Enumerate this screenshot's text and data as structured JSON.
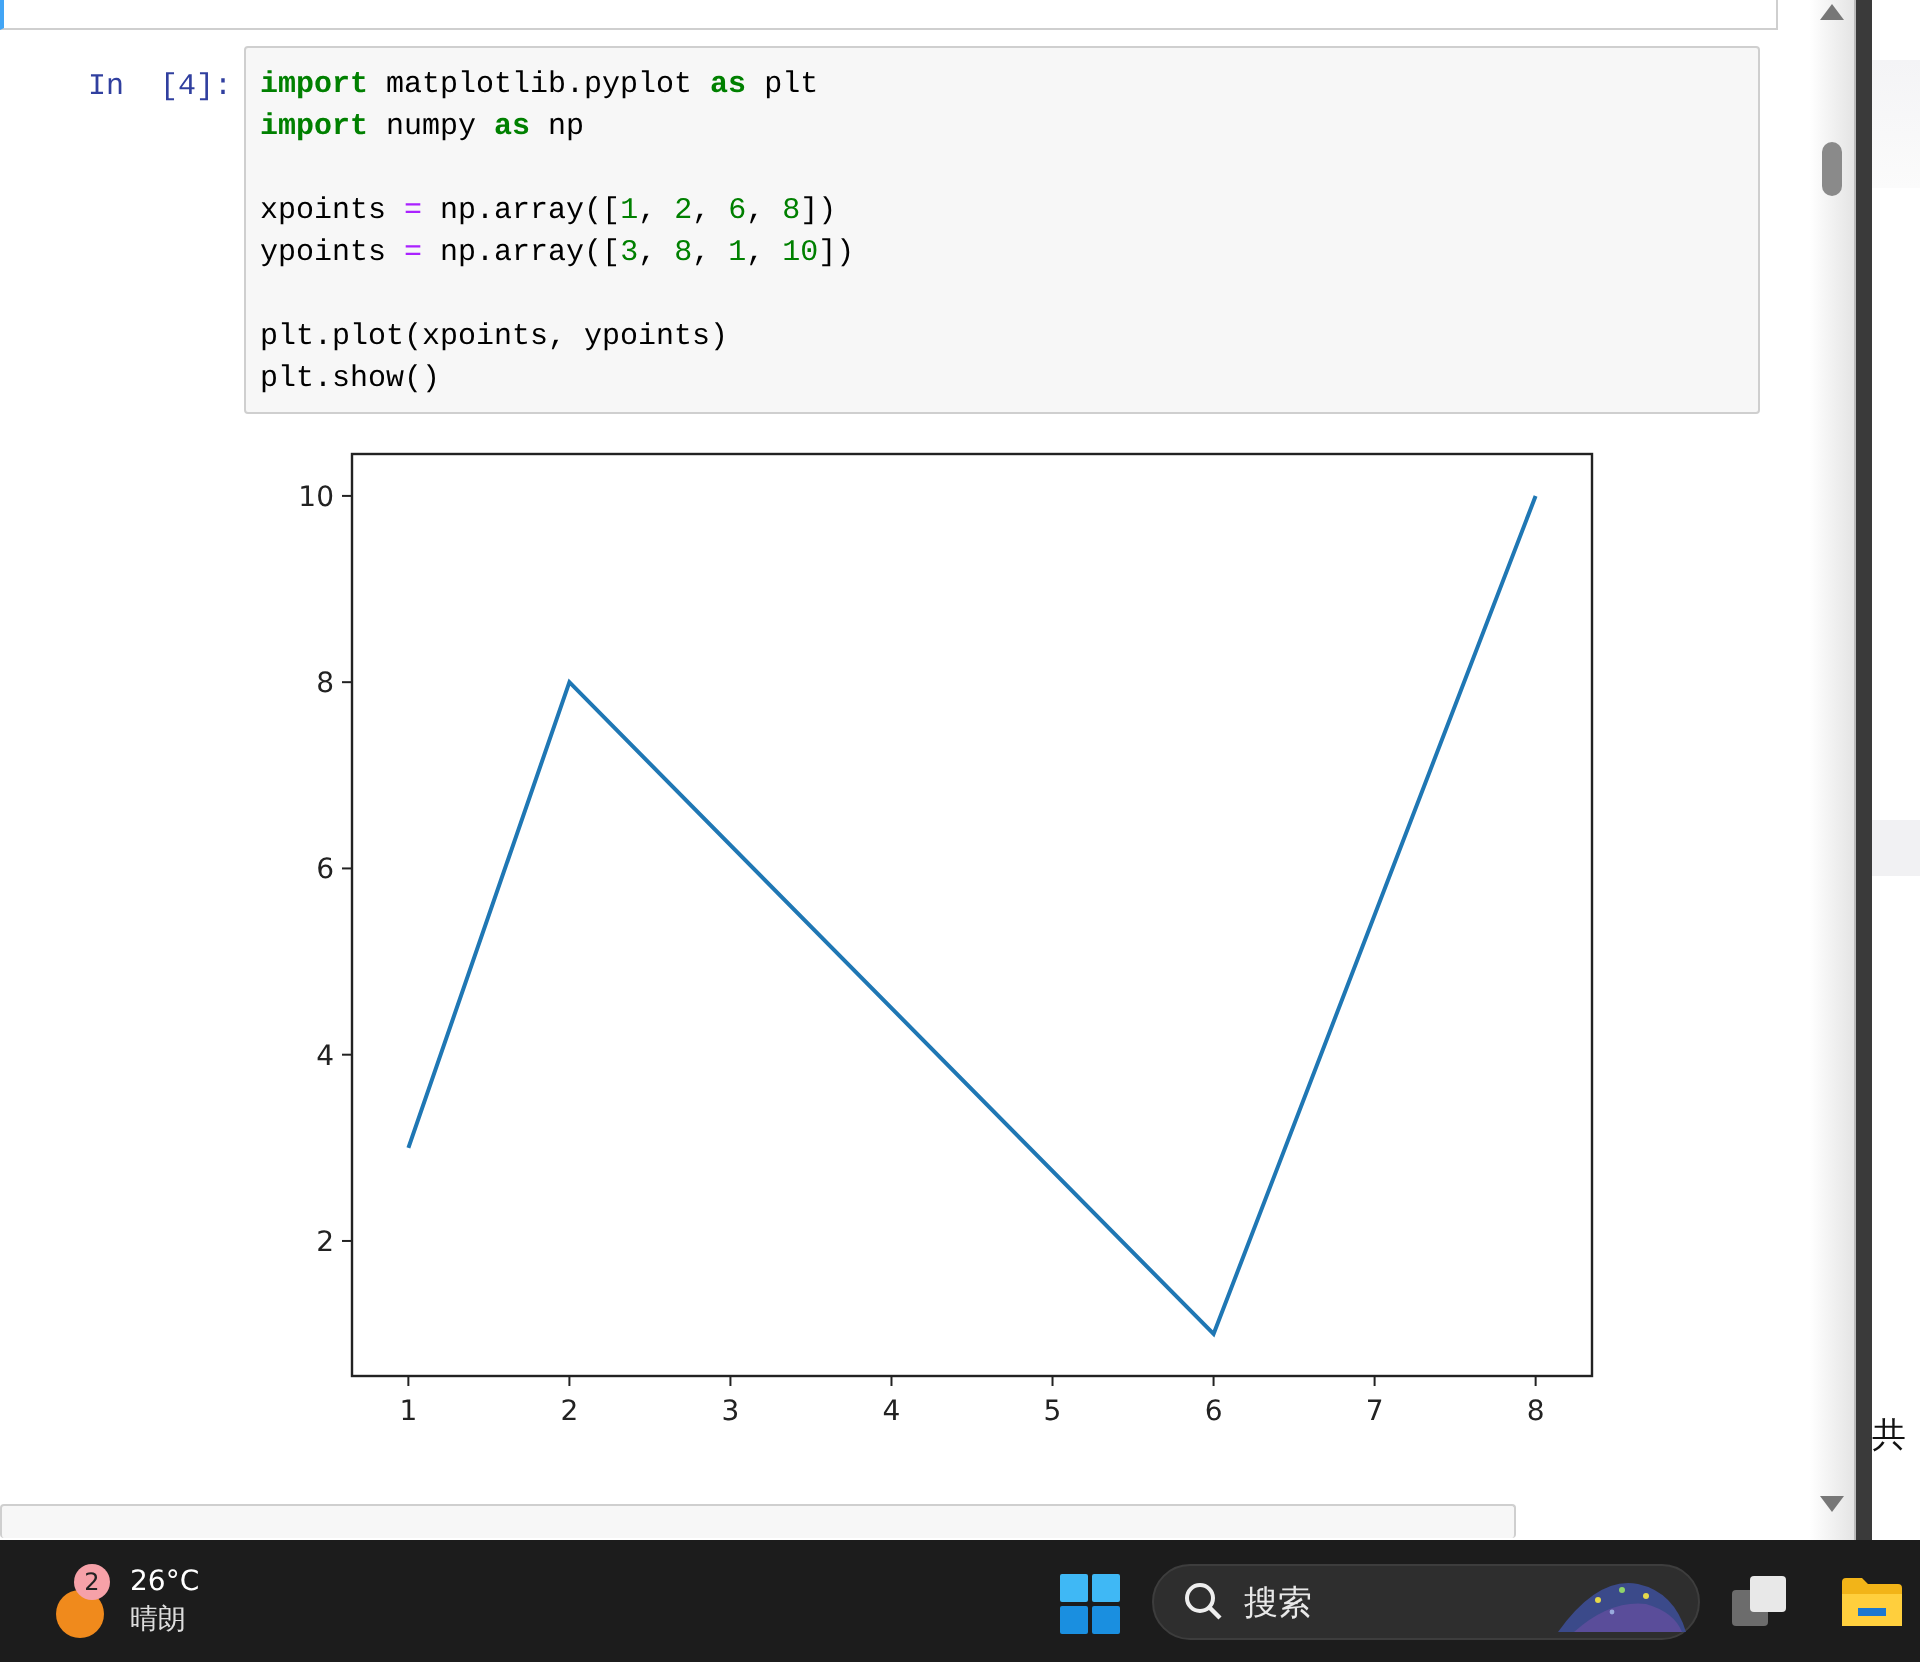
{
  "cell": {
    "prompt": "In  [4]:",
    "lines": [
      {
        "kind": "code",
        "tokens": [
          {
            "kind": "keyword",
            "text": "import"
          },
          {
            "kind": "plain",
            "text": " matplotlib.pyplot "
          },
          {
            "kind": "keyword",
            "text": "as"
          },
          {
            "kind": "plain",
            "text": " plt"
          }
        ]
      },
      {
        "kind": "code",
        "tokens": [
          {
            "kind": "keyword",
            "text": "import"
          },
          {
            "kind": "plain",
            "text": " numpy "
          },
          {
            "kind": "keyword",
            "text": "as"
          },
          {
            "kind": "plain",
            "text": " np"
          }
        ]
      },
      {
        "kind": "blank"
      },
      {
        "kind": "code",
        "tokens": [
          {
            "kind": "plain",
            "text": "xpoints "
          },
          {
            "kind": "operator",
            "text": "="
          },
          {
            "kind": "plain",
            "text": " np.array(["
          },
          {
            "kind": "number",
            "text": "1"
          },
          {
            "kind": "plain",
            "text": ", "
          },
          {
            "kind": "number",
            "text": "2"
          },
          {
            "kind": "plain",
            "text": ", "
          },
          {
            "kind": "number",
            "text": "6"
          },
          {
            "kind": "plain",
            "text": ", "
          },
          {
            "kind": "number",
            "text": "8"
          },
          {
            "kind": "plain",
            "text": "])"
          }
        ]
      },
      {
        "kind": "code",
        "tokens": [
          {
            "kind": "plain",
            "text": "ypoints "
          },
          {
            "kind": "operator",
            "text": "="
          },
          {
            "kind": "plain",
            "text": " np.array(["
          },
          {
            "kind": "number",
            "text": "3"
          },
          {
            "kind": "plain",
            "text": ", "
          },
          {
            "kind": "number",
            "text": "8"
          },
          {
            "kind": "plain",
            "text": ", "
          },
          {
            "kind": "number",
            "text": "1"
          },
          {
            "kind": "plain",
            "text": ", "
          },
          {
            "kind": "number",
            "text": "10"
          },
          {
            "kind": "plain",
            "text": "])"
          }
        ]
      },
      {
        "kind": "blank"
      },
      {
        "kind": "code",
        "tokens": [
          {
            "kind": "plain",
            "text": "plt.plot(xpoints, ypoints)"
          }
        ]
      },
      {
        "kind": "code",
        "tokens": [
          {
            "kind": "plain",
            "text": "plt.show()"
          }
        ]
      }
    ]
  },
  "output": {
    "chart_data": {
      "type": "line",
      "x": [
        1,
        2,
        6,
        8
      ],
      "series": [
        {
          "color": "#1f77b4",
          "values": [
            3,
            8,
            1,
            10
          ]
        }
      ],
      "xlim": [
        0.65,
        8.35
      ],
      "ylim": [
        0.55,
        10.45
      ],
      "xticks": [
        1,
        2,
        3,
        4,
        5,
        6,
        7,
        8
      ],
      "yticks": [
        2,
        4,
        6,
        8,
        10
      ]
    }
  },
  "side_pane": {
    "text": "共"
  },
  "taskbar": {
    "weather": {
      "badge": "2",
      "temperature": "26°C",
      "condition": "晴朗"
    },
    "search": {
      "placeholder": "搜索"
    }
  }
}
